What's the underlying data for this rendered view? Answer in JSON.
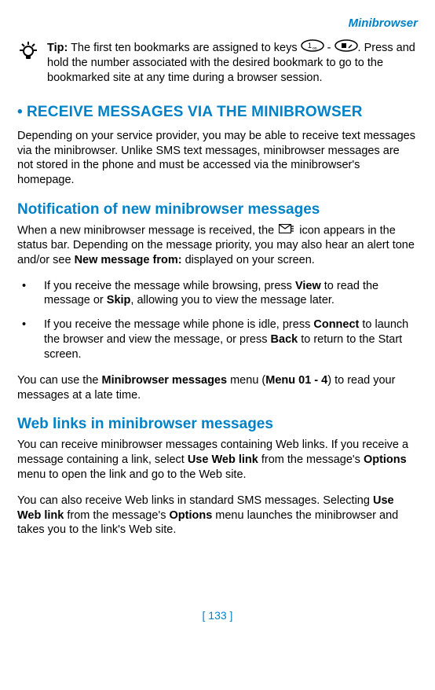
{
  "header": "Minibrowser",
  "tip": {
    "label": "Tip:",
    "text_before": " The first ten bookmarks are assigned to keys ",
    "dash": " - ",
    "text_after": ". Press and hold the number associated with the desired bookmark to go to the bookmarked site at any time during a browser session."
  },
  "section1": {
    "bullet": "•",
    "title": "RECEIVE MESSAGES VIA THE MINIBROWSER",
    "para": "Depending on your service provider, you may be able to receive text messages via the minibrowser. Unlike SMS text messages, minibrowser messages are not stored in the phone and must be accessed via the minibrowser's homepage."
  },
  "section2": {
    "title": "Notification of new minibrowser messages",
    "para_a": "When a new minibrowser message is received, the ",
    "para_b": " icon appears in the status bar. Depending on the message priority, you may also hear an alert tone and/or see ",
    "bold1": "New message from:",
    "para_c": " displayed on your screen.",
    "li1_a": "If you receive the message while browsing, press ",
    "li1_b1": "View",
    "li1_c": " to read the message or ",
    "li1_b2": "Skip",
    "li1_d": ", allowing you to view the message later.",
    "li2_a": "If you receive the message while phone is idle, press ",
    "li2_b1": "Connect",
    "li2_c": " to launch the browser and view the message, or press ",
    "li2_b2": "Back",
    "li2_d": " to return to the Start screen.",
    "after_a": "You can use the ",
    "after_b1": "Minibrowser messages",
    "after_c": " menu (",
    "after_b2": "Menu 01 - 4",
    "after_d": ") to read your messages at a late time."
  },
  "section3": {
    "title": "Web links in minibrowser messages",
    "p1_a": "You can receive minibrowser messages containing Web links. If you receive a message containing a link, select ",
    "p1_b1": "Use Web link",
    "p1_c": " from the message's ",
    "p1_b2": "Options",
    "p1_d": " menu to open the link and go to the Web site.",
    "p2_a": "You can also receive Web links in standard SMS messages. Selecting ",
    "p2_b1": "Use Web link",
    "p2_c": " from the message's ",
    "p2_b2": "Options",
    "p2_d": " menu launches the minibrowser and takes you to the link's Web site."
  },
  "pagenum": "[ 133 ]"
}
